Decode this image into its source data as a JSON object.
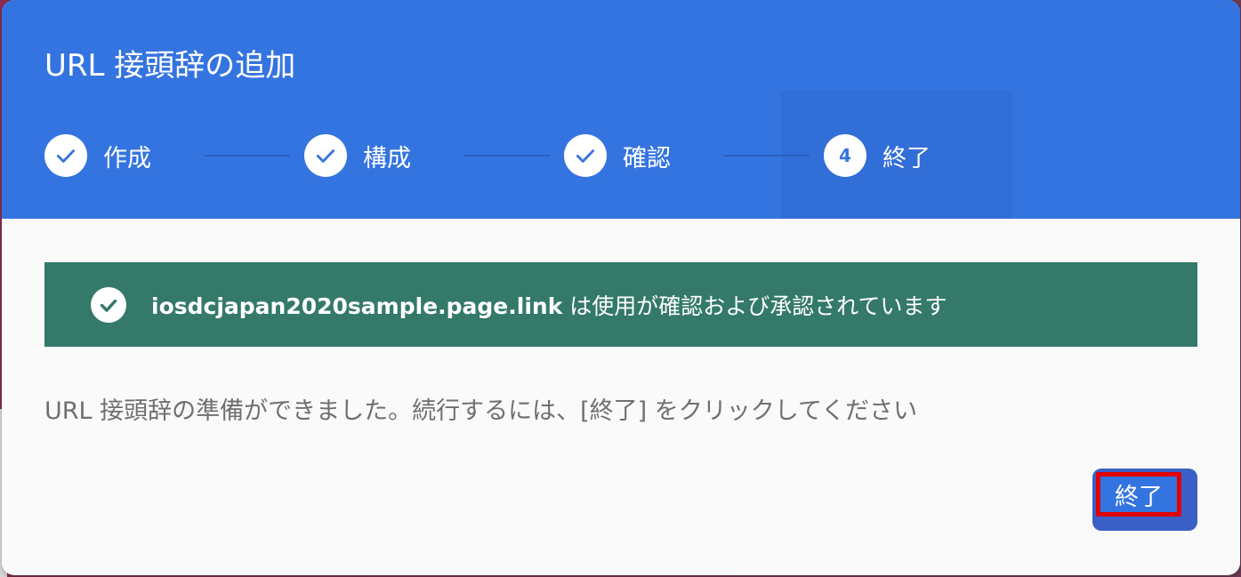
{
  "dialog": {
    "title": "URL 接頭辞の追加"
  },
  "stepper": {
    "steps": [
      {
        "label": "作成",
        "state": "complete",
        "icon": "check-icon"
      },
      {
        "label": "構成",
        "state": "complete",
        "icon": "check-icon"
      },
      {
        "label": "確認",
        "state": "complete",
        "icon": "check-icon"
      },
      {
        "label": "終了",
        "state": "current",
        "number": "4"
      }
    ]
  },
  "banner": {
    "domain": "iosdcjapan2020sample.page.link",
    "message": "は使用が確認および承認されています",
    "icon": "check-circle-icon"
  },
  "body": {
    "text": "URL 接頭辞の準備ができました。続行するには、[終了] をクリックしてください"
  },
  "actions": {
    "finish_label": "終了"
  },
  "colors": {
    "header": "#3474e0",
    "banner": "#34796a",
    "highlight_border": "#e00000"
  }
}
